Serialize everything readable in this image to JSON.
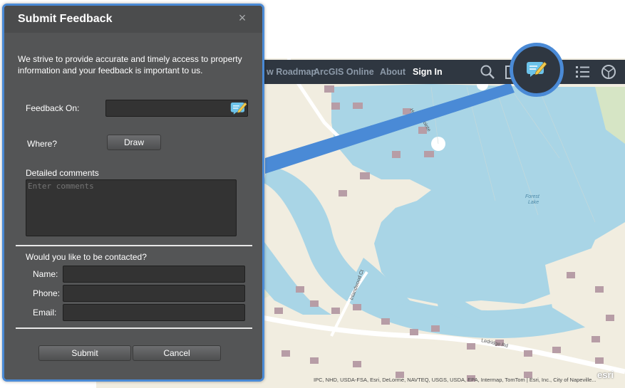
{
  "toolbar": {
    "links": [
      "w Roadmap",
      "ArcGIS Online",
      "About",
      "Sign In"
    ],
    "active_link": "Sign In",
    "icons": [
      "search-icon",
      "bookmark-icon",
      "feedback-icon",
      "list-icon",
      "basemap-gallery-icon"
    ]
  },
  "map": {
    "labels": {
      "lake": "Forest",
      "lake2": "Lake",
      "road1": "Ledridge Rd",
      "road2": "Inlandwood Ct",
      "road3": "Pointe",
      "road4": "He"
    },
    "attribution": "IPC, NHD, USDA-FSA, Esri, DeLorme, NAVTEQ, USGS, USDA, EPA, Intermap, TomTom | Esri, Inc., City of Napeville...",
    "logo": "esri",
    "colors": {
      "water": "#a9d5e6",
      "land": "#f3efe3",
      "buildings": "#b79da6",
      "accent": "#4a8ad6"
    }
  },
  "dialog": {
    "title": "Submit Feedback",
    "close": "×",
    "intro": "We strive to provide accurate and timely access to property information and your feedback is important to us.",
    "feedback_on_label": "Feedback On:",
    "feedback_on_value": "",
    "where_label": "Where?",
    "draw_button": "Draw",
    "comments_label": "Detailed comments",
    "comments_placeholder": "Enter comments",
    "contact_question": "Would you like to be contacted?",
    "name_label": "Name:",
    "phone_label": "Phone:",
    "email_label": "Email:",
    "name_value": "",
    "phone_value": "",
    "email_value": "",
    "submit_button": "Submit",
    "cancel_button": "Cancel"
  }
}
